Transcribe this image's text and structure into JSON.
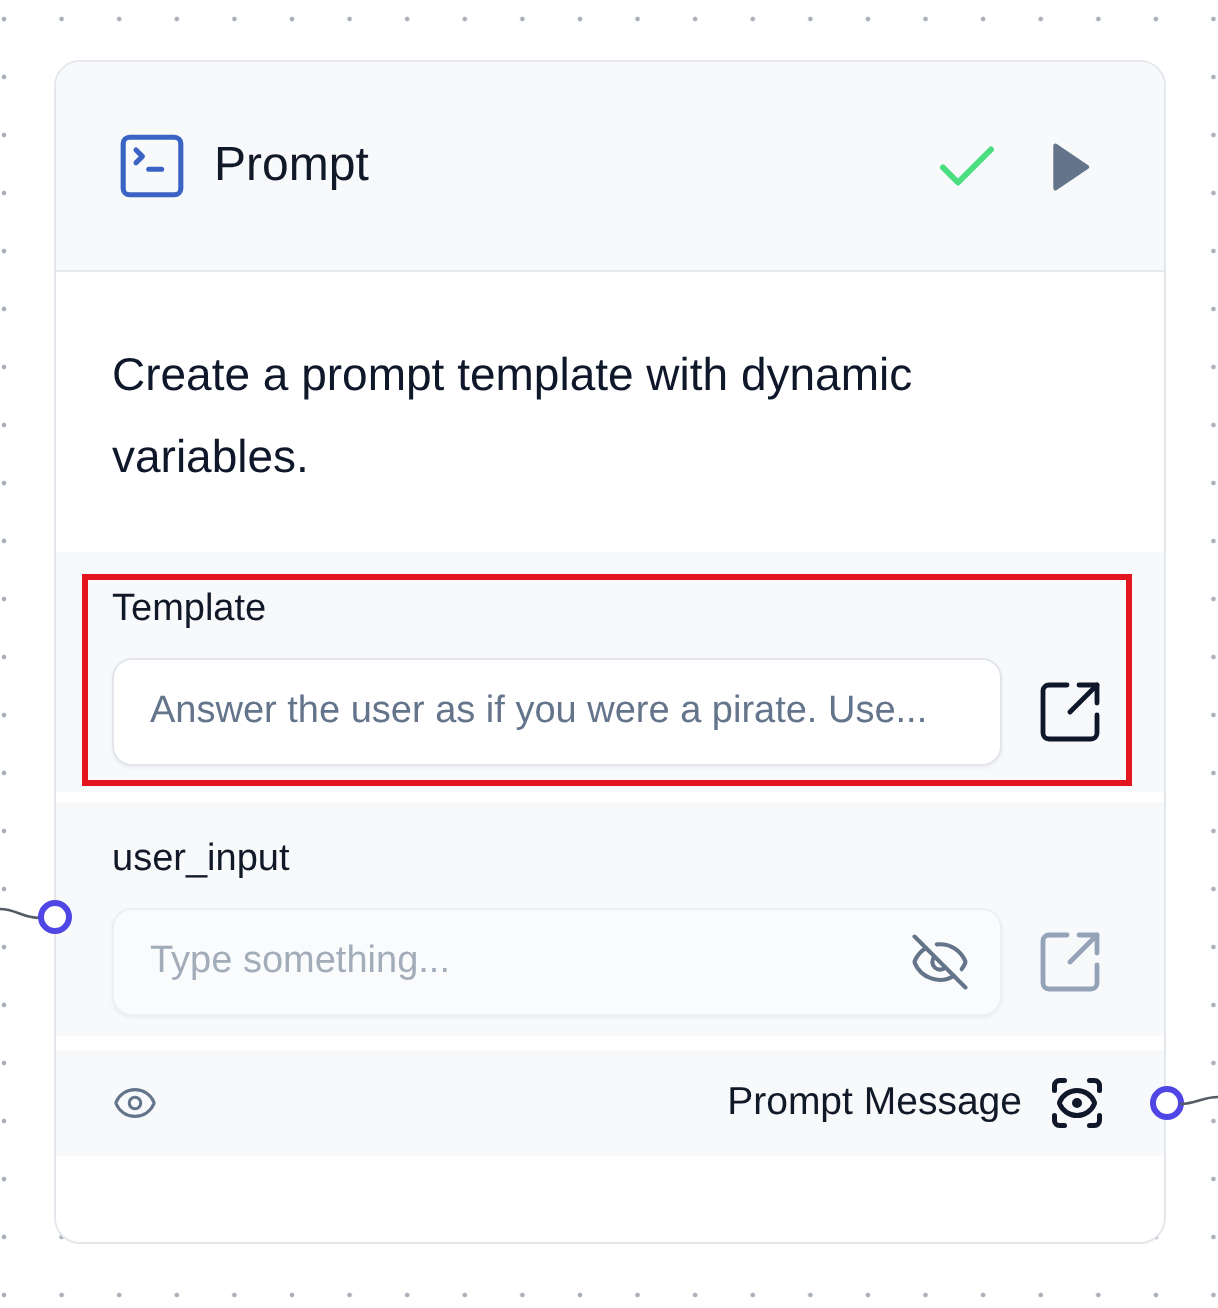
{
  "node": {
    "title": "Prompt",
    "validated": true,
    "description": "Create a prompt template with dynamic variables."
  },
  "fields": [
    {
      "label": "Template",
      "value": "Answer the user as if you were a pirate. Use...",
      "highlighted": true,
      "disabled": false,
      "connected": false,
      "visibility_toggle": false
    },
    {
      "label": "user_input",
      "placeholder": "Type something...",
      "highlighted": false,
      "disabled": true,
      "connected": true,
      "visibility_toggle": true
    }
  ],
  "output": {
    "label": "Prompt Message",
    "visible": true,
    "connected": true
  }
}
